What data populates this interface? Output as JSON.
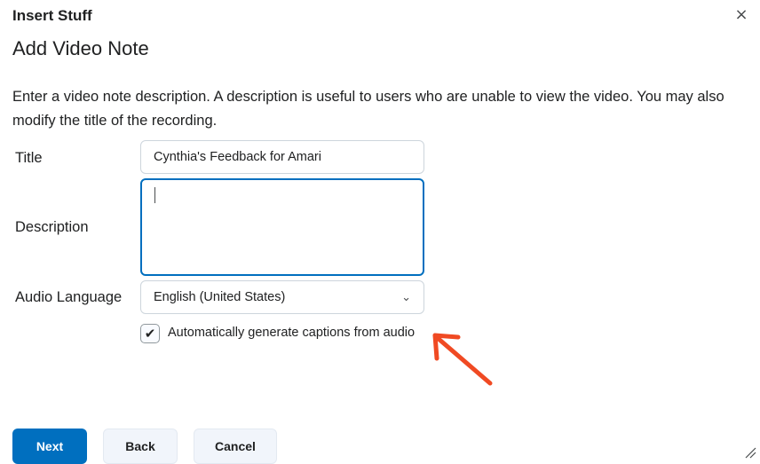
{
  "dialog": {
    "title": "Insert Stuff",
    "close_icon": "close-icon",
    "close_glyph": "×"
  },
  "page": {
    "title": "Add Video Note",
    "intro": "Enter a video note description. A description is useful to users who are unable to view the video. You may also modify the title of the recording."
  },
  "form": {
    "title_label": "Title",
    "title_value": "Cynthia's Feedback for Amari",
    "description_label": "Description",
    "description_value": "",
    "language_label": "Audio Language",
    "language_selected": "English (United States)",
    "captions_label": "Automatically generate captions from audio",
    "captions_checked": true,
    "check_glyph": "✔",
    "chevron_glyph": "⌄"
  },
  "buttons": {
    "next": "Next",
    "back": "Back",
    "cancel": "Cancel"
  },
  "colors": {
    "primary": "#006fbf",
    "annotation_arrow": "#f04a23"
  }
}
